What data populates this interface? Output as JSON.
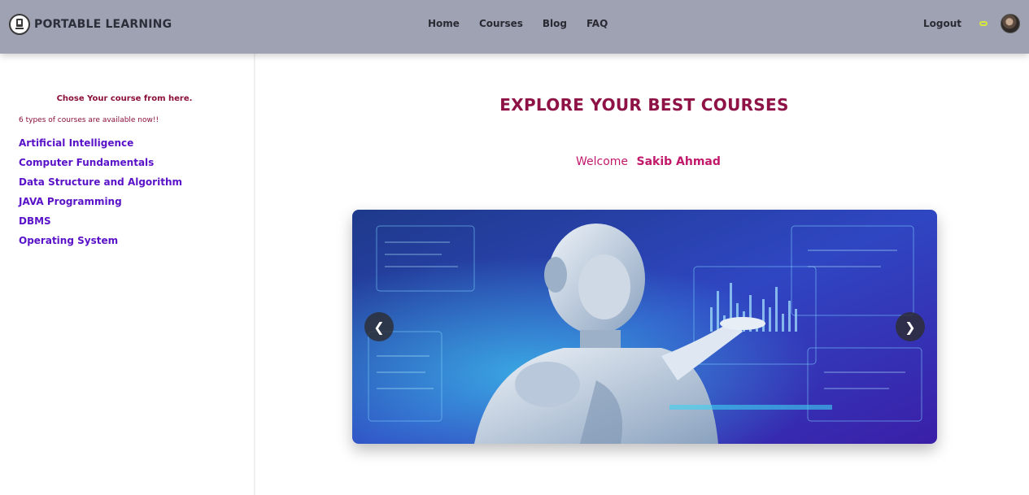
{
  "brand": {
    "name": "PORTABLE LEARNING"
  },
  "nav": {
    "links": [
      "Home",
      "Courses",
      "Blog",
      "FAQ"
    ],
    "logout": "Logout"
  },
  "sidebar": {
    "heading": "Chose Your course from here.",
    "subtext": "6 types of courses are available now!!",
    "courses": [
      "Artificial Intelligence",
      "Computer Fundamentals",
      "Data Structure and Algorithm",
      "JAVA Programming",
      "DBMS",
      "Operating System"
    ]
  },
  "main": {
    "title": "EXPLORE YOUR BEST COURSES",
    "welcome_label": "Welcome",
    "user_name": "Sakib Ahmad"
  },
  "carousel": {
    "prev_glyph": "❮",
    "next_glyph": "❯"
  },
  "colors": {
    "navbar": "#9ea2b3",
    "title": "#8e1245",
    "welcome": "#c2186b",
    "course_link": "#5a12c8"
  }
}
